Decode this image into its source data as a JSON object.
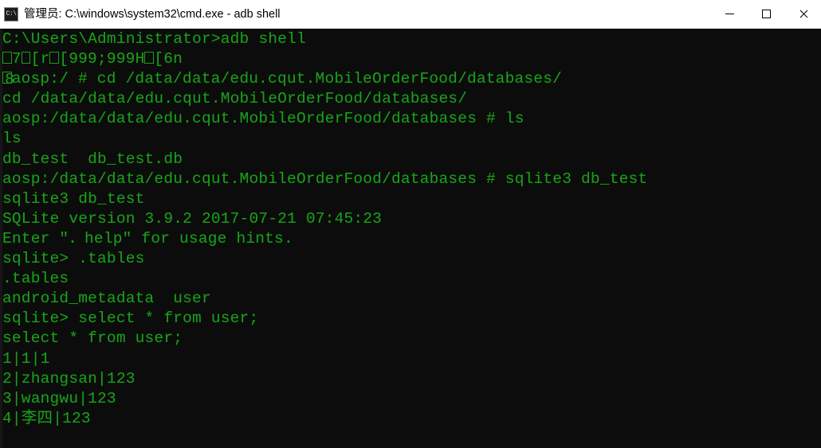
{
  "window": {
    "title": "管理员: C:\\windows\\system32\\cmd.exe - adb  shell",
    "icon": "cmd-icon",
    "icon_label": "C:\\",
    "background_color": "#0c0c0c",
    "text_color": "#19a019",
    "titlebar_color": "#ffffff"
  },
  "controls": {
    "minimize_label": "Minimize",
    "maximize_label": "Maximize",
    "close_label": "Close"
  },
  "console": {
    "lines": [
      {
        "id": "l1",
        "text": "C:\\Users\\Administrator>adb shell"
      },
      {
        "id": "l2",
        "text": "7[r[999;999H[6n",
        "prefix_box": true,
        "escapes": true
      },
      {
        "id": "l3",
        "text": "8aosp:/ # cd /data/data/edu.cqut.MobileOrderFood/databases/",
        "prefix_overlap": true
      },
      {
        "id": "l4",
        "text": "cd /data/data/edu.cqut.MobileOrderFood/databases/"
      },
      {
        "id": "l5",
        "text": "aosp:/data/data/edu.cqut.MobileOrderFood/databases # ls"
      },
      {
        "id": "l6",
        "text": "ls"
      },
      {
        "id": "l7",
        "text": "db_test  db_test.db"
      },
      {
        "id": "l8",
        "text": "aosp:/data/data/edu.cqut.MobileOrderFood/databases # sqlite3 db_test"
      },
      {
        "id": "l9",
        "text": "sqlite3 db_test"
      },
      {
        "id": "l10",
        "text": "SQLite version 3.9.2 2017-07-21 07:45:23"
      },
      {
        "id": "l11",
        "text": "Enter \"．help\" for usage hints."
      },
      {
        "id": "l12",
        "text": "sqlite> .tables"
      },
      {
        "id": "l13",
        "text": ".tables"
      },
      {
        "id": "l14",
        "text": "android_metadata  user"
      },
      {
        "id": "l15",
        "text": "sqlite> select * from user;"
      },
      {
        "id": "l16",
        "text": "select * from user;"
      },
      {
        "id": "l17",
        "text": "1|1|1"
      },
      {
        "id": "l18",
        "text": "2|zhangsan|123"
      },
      {
        "id": "l19",
        "text": "3|wangwu|123"
      },
      {
        "id": "l20",
        "text": "4|李四|123"
      }
    ]
  },
  "session": {
    "shell_command": "adb shell",
    "device_prompt": "aosp:/",
    "working_directory": "/data/data/edu.cqut.MobileOrderFood/databases",
    "database_file": "db_test",
    "sqlite_version": "3.9.2",
    "sqlite_build_date": "2017-07-21 07:45:23",
    "tables": [
      "android_metadata",
      "user"
    ],
    "files_listed": [
      "db_test",
      "db_test.db"
    ],
    "query": "select * from user;",
    "rows": [
      {
        "id": "1",
        "name": "1",
        "password": "1"
      },
      {
        "id": "2",
        "name": "zhangsan",
        "password": "123"
      },
      {
        "id": "3",
        "name": "wangwu",
        "password": "123"
      },
      {
        "id": "4",
        "name": "李四",
        "password": "123"
      }
    ]
  }
}
